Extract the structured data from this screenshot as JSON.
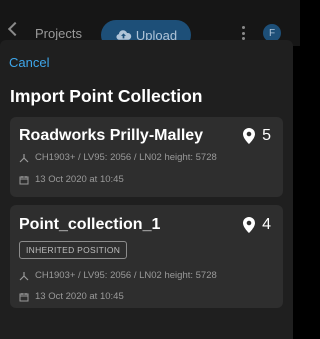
{
  "header": {
    "title": "Projects",
    "upload_label": "Upload",
    "avatar_initial": "F"
  },
  "sheet": {
    "cancel_label": "Cancel",
    "title": "Import Point Collection"
  },
  "collections": [
    {
      "name": "Roadworks Prilly-Malley",
      "count": "5",
      "crs": "CH1903+ / LV95: 2056 / LN02 height: 5728",
      "date": "13 Oct 2020 at 10:45"
    },
    {
      "name": "Point_collection_1",
      "count": "4",
      "badge": "INHERITED POSITION",
      "crs": "CH1903+ / LV95: 2056 / LN02 height: 5728",
      "date": "13 Oct 2020 at 10:45"
    }
  ],
  "colors": {
    "accent": "#3ea6ea",
    "card_bg": "#2e2e2e",
    "sheet_bg": "#1f1f1f"
  }
}
